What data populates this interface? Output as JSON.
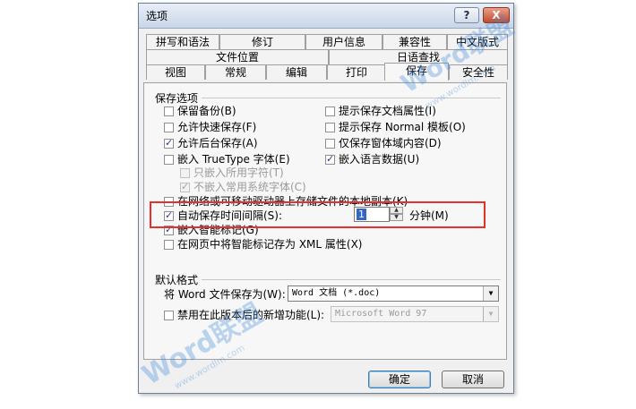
{
  "dialog": {
    "title": "选项",
    "help_label": "?",
    "close_label": "X"
  },
  "tabs": {
    "row1": [
      "拼写和语法",
      "修订",
      "用户信息",
      "兼容性",
      "中文版式"
    ],
    "row2": [
      "文件位置",
      "日语查找"
    ],
    "row3": [
      "视图",
      "常规",
      "编辑",
      "打印",
      "保存",
      "安全性"
    ],
    "active": "保存"
  },
  "save_options": {
    "group_title": "保存选项",
    "left": [
      {
        "label": "保留备份(B)",
        "checked": false,
        "enabled": true
      },
      {
        "label": "允许快速保存(F)",
        "checked": false,
        "enabled": true
      },
      {
        "label": "允许后台保存(A)",
        "checked": true,
        "enabled": true
      },
      {
        "label": "嵌入 TrueType 字体(E)",
        "checked": false,
        "enabled": true
      },
      {
        "label": "只嵌入所用字符(T)",
        "checked": false,
        "enabled": false
      },
      {
        "label": "不嵌入常用系统字体(C)",
        "checked": true,
        "enabled": false
      }
    ],
    "right": [
      {
        "label": "提示保存文档属性(I)",
        "checked": false
      },
      {
        "label": "提示保存 Normal 模板(O)",
        "checked": false
      },
      {
        "label": "仅保存窗体域内容(D)",
        "checked": false
      },
      {
        "label": "嵌入语言数据(U)",
        "checked": true
      }
    ],
    "local_copy": {
      "label": "在网络或可移动驱动器上存储文件的本地副本(K)",
      "checked": false
    },
    "autosave": {
      "label": "自动保存时间间隔(S):",
      "checked": true,
      "value": "1",
      "unit": "分钟(M)"
    },
    "smart_tags": {
      "label": "嵌入智能标记(G)",
      "checked": true
    },
    "xml_tags": {
      "label": "在网页中将智能标记存为 XML 属性(X)",
      "checked": false
    }
  },
  "default_format": {
    "group_title": "默认格式",
    "save_as_label": "将 Word 文件保存为(W):",
    "save_as_value": "Word 文档 (*.doc)",
    "disable_features_label": "禁用在此版本后的新增功能(L):",
    "disable_features_checked": false,
    "disable_features_value": "Microsoft Word 97"
  },
  "buttons": {
    "ok": "确定",
    "cancel": "取消"
  },
  "watermarks": {
    "logo": "Word联盟",
    "url": "www.wordlm.com"
  }
}
